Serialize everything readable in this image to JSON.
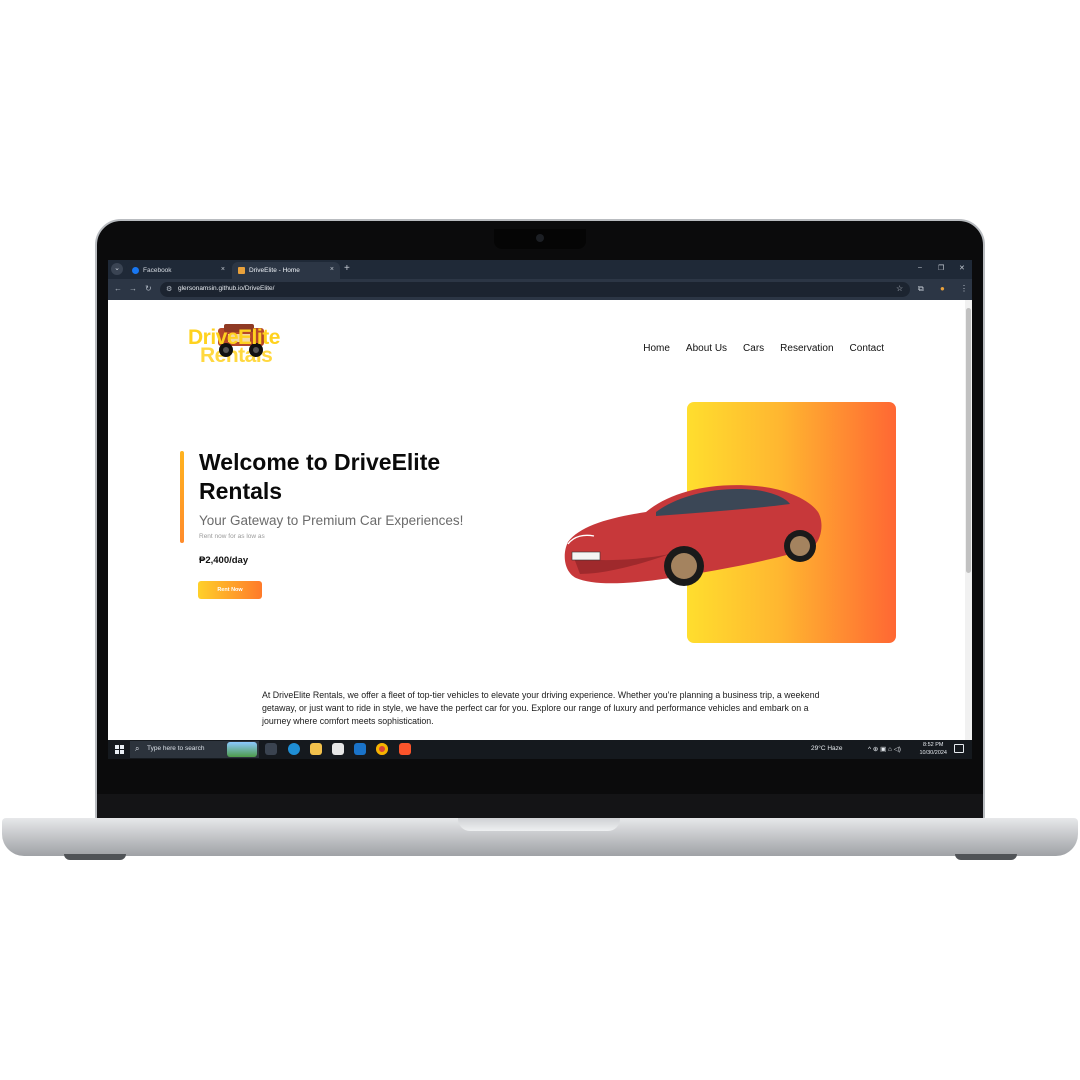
{
  "browser": {
    "tabs": [
      {
        "title": "Facebook",
        "close": "×"
      },
      {
        "title": "DriveElite - Home",
        "close": "×"
      }
    ],
    "new_tab": "+",
    "window_controls": {
      "minimize": "–",
      "restore": "❐",
      "close": "✕"
    },
    "url": "glersonamsin.github.io/DriveElite/",
    "nav": {
      "back": "←",
      "forward": "→",
      "reload": "↻"
    }
  },
  "site": {
    "logo": {
      "line1": "DriveElite",
      "line2": "Rentals"
    },
    "menu": [
      "Home",
      "About Us",
      "Cars",
      "Reservation",
      "Contact"
    ],
    "hero": {
      "title": "Welcome to DriveElite Rentals",
      "subtitle": "Your Gateway to Premium Car Experiences!",
      "small": "Rent now for as low as",
      "price": "₱2,400/day",
      "cta": "Rent Now"
    },
    "about": "At DriveElite Rentals, we offer a fleet of top-tier vehicles to elevate your driving experience. Whether you're planning a business trip, a weekend getaway, or just want to ride in style, we have the perfect car for you. Explore our range of luxury and performance vehicles and embark on a journey where comfort meets sophistication."
  },
  "taskbar": {
    "search_placeholder": "Type here to search",
    "weather": "29°C  Haze",
    "time": "8:52 PM",
    "date": "10/30/2024"
  },
  "colors": {
    "accent_start": "#ffde2e",
    "accent_end": "#ff6733",
    "logo_yellow": "#ffd21f",
    "car_red": "#c7383a"
  },
  "icons": [
    "facebook-icon",
    "driveelite-favicon",
    "search-icon",
    "windows-icon",
    "star-icon",
    "extensions-icon",
    "more-icon"
  ]
}
